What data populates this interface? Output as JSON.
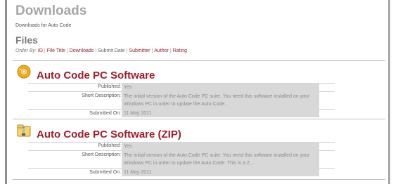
{
  "header": {
    "title": "Downloads",
    "subtitle": "Downloads for Auto Code"
  },
  "section": {
    "title": "Files"
  },
  "order_by": {
    "label": "Order By",
    "options": [
      {
        "text": "ID",
        "link": true
      },
      {
        "text": "File Title",
        "link": true
      },
      {
        "text": "Downloads",
        "link": true
      },
      {
        "text": "Submit Date",
        "link": false
      },
      {
        "text": "Submitter",
        "link": true
      },
      {
        "text": "Author",
        "link": true
      },
      {
        "text": "Rating",
        "link": true
      }
    ]
  },
  "files": [
    {
      "icon": "software-cd-icon",
      "title": "Auto Code PC Software",
      "published_label": "Published:",
      "published_value": "Yes",
      "description_label": "Short Description:",
      "description_value": "The initial version of the Auto Code PC suite. You need this software installed on your Windows PC in order to update the Auto Code.",
      "submitted_label": "Submitted On:",
      "submitted_value": "11 May 2011"
    },
    {
      "icon": "zip-archive-icon",
      "title": "Auto Code PC Software (ZIP)",
      "published_label": "Published:",
      "published_value": "Yes",
      "description_label": "Short Description:",
      "description_value": "The initial version of the Auto Code PC suite. You need this software installed on your Windows PC in order to update the Auto Code.  This is a Z...",
      "submitted_label": "Submitted On:",
      "submitted_value": "11 May 2011"
    }
  ],
  "colors": {
    "link": "#a01c2a",
    "heading": "#a6a6a6",
    "value_bg": "#d8d8d8"
  }
}
